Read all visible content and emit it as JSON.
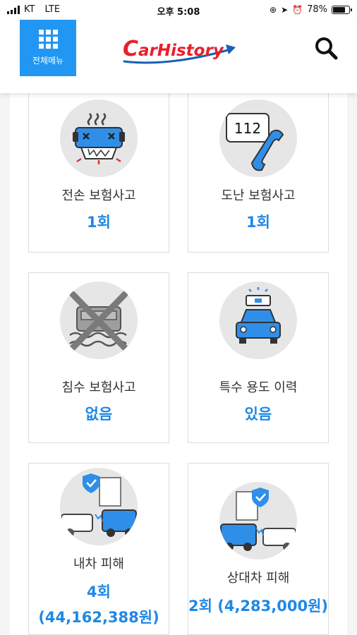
{
  "status_bar": {
    "carrier": "KT",
    "network": "LTE",
    "time": "오후 5:08",
    "battery": "78%",
    "battery_level": 0.78
  },
  "header": {
    "menu_label": "전체메뉴",
    "logo_text": "CarHistory"
  },
  "colors": {
    "accent": "#2196f3",
    "value_blue": "#1e88e5",
    "logo_red": "#e8202a",
    "logo_blue": "#1a5fb4"
  },
  "cards": [
    {
      "title": "전손 보험사고",
      "value": "1회",
      "icon": "total-loss-car-icon"
    },
    {
      "title": "도난 보험사고",
      "value": "1회",
      "icon": "phone-112-icon"
    },
    {
      "title": "침수 보험사고",
      "value": "없음",
      "icon": "flooded-car-icon"
    },
    {
      "title": "특수 용도 이력",
      "value": "있음",
      "icon": "taxi-icon"
    },
    {
      "title": "내차 피해",
      "value": "4회",
      "amount": "(44,162,388원)",
      "icon": "my-car-damage-icon"
    },
    {
      "title": "상대차 피해",
      "value": "2회 (4,283,000원)",
      "icon": "other-car-damage-icon",
      "phone_label": "112"
    }
  ]
}
